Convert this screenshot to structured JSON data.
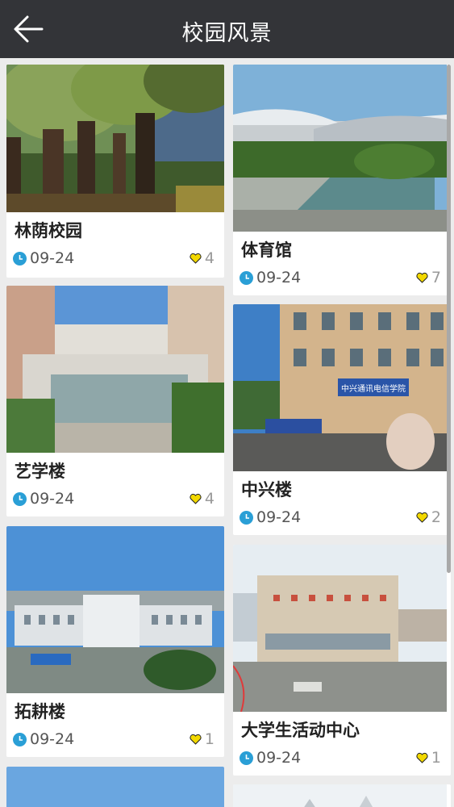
{
  "header": {
    "title": "校园风景",
    "back_icon": "back-arrow-icon"
  },
  "cards": [
    {
      "caption": "林荫校园",
      "date": "09-24",
      "likes": "4"
    },
    {
      "caption": "体育馆",
      "date": "09-24",
      "likes": "7"
    },
    {
      "caption": "艺学楼",
      "date": "09-24",
      "likes": "4"
    },
    {
      "caption": "中兴楼",
      "date": "09-24",
      "likes": "2"
    },
    {
      "caption": "拓耕楼",
      "date": "09-24",
      "likes": "1"
    },
    {
      "caption": "大学生活动中心",
      "date": "09-24",
      "likes": "1"
    }
  ],
  "photo_signs": {
    "zhongxing": "中兴通讯电信学院"
  },
  "icons": {
    "date": "clock-icon",
    "likes": "heart-icon"
  },
  "colors": {
    "header_bg": "#333438",
    "clock": "#2a9fd6",
    "heart": "#f2d800"
  }
}
